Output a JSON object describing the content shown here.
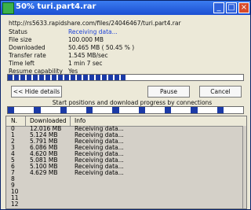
{
  "window": {
    "title": "50% turi.part4.rar",
    "controls": {
      "minimize_icon": "minimize-icon",
      "maximize_icon": "maximize-icon",
      "close_icon": "close-icon"
    }
  },
  "info": {
    "url": "http://rs5633.rapidshare.com/files/24046467/turi.part4.rar",
    "fields": [
      {
        "label": "Status",
        "value": "Receiving data..."
      },
      {
        "label": "File size",
        "value": "100.000 MB"
      },
      {
        "label": "Downloaded",
        "value": "50.465 MB  ( 50.45 % )"
      },
      {
        "label": "Transfer rate",
        "value": "1.545 MB/sec"
      },
      {
        "label": "Time left",
        "value": "1 min 7 sec"
      },
      {
        "label": "Resume capability",
        "value": "Yes"
      }
    ]
  },
  "progress": {
    "percent": 50.45
  },
  "buttons": {
    "hide_details": "<< Hide details",
    "pause": "Pause",
    "cancel": "Cancel"
  },
  "connections": {
    "title": "Start positions and download progress by connections",
    "segments": [
      {
        "color": "blue",
        "w": 8
      },
      {
        "color": "white",
        "w": 24
      },
      {
        "color": "blue",
        "w": 8
      },
      {
        "color": "white",
        "w": 24
      },
      {
        "color": "blue",
        "w": 8
      },
      {
        "color": "white",
        "w": 24
      },
      {
        "color": "blue",
        "w": 8
      },
      {
        "color": "white",
        "w": 24
      },
      {
        "color": "blue",
        "w": 8
      },
      {
        "color": "white",
        "w": 24
      },
      {
        "color": "blue",
        "w": 8
      },
      {
        "color": "white",
        "w": 24
      },
      {
        "color": "blue",
        "w": 8
      },
      {
        "color": "white",
        "w": 24
      },
      {
        "color": "blue",
        "w": 8
      },
      {
        "color": "white",
        "w": 24
      },
      {
        "color": "blue",
        "w": 8
      },
      {
        "color": "white",
        "w": 24
      }
    ]
  },
  "table": {
    "columns": [
      "N.",
      "Downloaded",
      "Info"
    ],
    "rows": [
      {
        "n": "0",
        "downloaded": "12.016 MB",
        "info": "Receiving data..."
      },
      {
        "n": "1",
        "downloaded": "5.124 MB",
        "info": "Receiving data..."
      },
      {
        "n": "2",
        "downloaded": "5.791 MB",
        "info": "Receiving data..."
      },
      {
        "n": "3",
        "downloaded": "6.086 MB",
        "info": "Receiving data..."
      },
      {
        "n": "4",
        "downloaded": "4.620 MB",
        "info": "Receiving data..."
      },
      {
        "n": "5",
        "downloaded": "5.081 MB",
        "info": "Receiving data..."
      },
      {
        "n": "6",
        "downloaded": "5.100 MB",
        "info": "Receiving data..."
      },
      {
        "n": "7",
        "downloaded": "4.629 MB",
        "info": "Receiving data..."
      },
      {
        "n": "8",
        "downloaded": "",
        "info": ""
      },
      {
        "n": "9",
        "downloaded": "",
        "info": ""
      },
      {
        "n": "10",
        "downloaded": "",
        "info": ""
      },
      {
        "n": "11",
        "downloaded": "",
        "info": ""
      },
      {
        "n": "12",
        "downloaded": "",
        "info": ""
      }
    ]
  }
}
